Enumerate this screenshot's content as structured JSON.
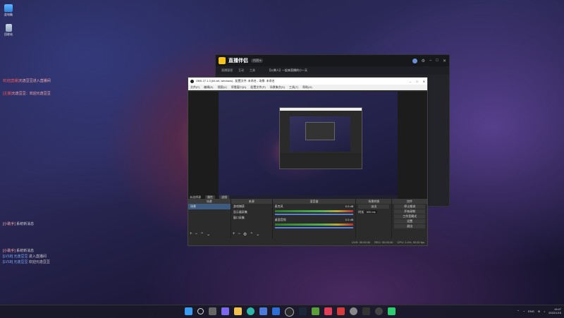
{
  "desktop": {
    "icons": [
      {
        "label": "此电脑",
        "icon": "computer-icon"
      },
      {
        "label": "回收站",
        "icon": "recycle-bin-icon"
      }
    ]
  },
  "chat_overlay": {
    "top": [
      {
        "user": "欢迎[直播]",
        "text": "元逸豆豆进入直播间"
      },
      {
        "user": "[主播]",
        "text": "元逸豆豆：欢迎元逸豆豆"
      }
    ],
    "bottom": [
      {
        "user": "[小助手]",
        "text": "系统新消息"
      },
      {
        "user": "[小助手]",
        "text": "系统新消息"
      },
      {
        "user": "[LV18] 元逸豆豆",
        "text": "进入直播间"
      },
      {
        "user": "[LV18] 元逸豆豆",
        "text": "欢迎元逸豆豆"
      }
    ]
  },
  "live_assistant": {
    "brand": "直播伴侣",
    "badge": "内测 ▾",
    "tabs": [
      "直播管理",
      "互动",
      "工具"
    ],
    "title_text": "【火柴人】一起来直播的小一天"
  },
  "obs": {
    "title": "OBS 27.1.3 (64-bit, windows) - 配置文件: 未命名 - 场景: 未命名",
    "menu": [
      "文件(F)",
      "编辑(E)",
      "视图(V)",
      "停靠窗口(D)",
      "配置文件(P)",
      "场景集合(S)",
      "工具(T)",
      "帮助(H)"
    ],
    "preview_label": "未选择源",
    "toolbar": {
      "props": "属性",
      "filters": "滤镜"
    },
    "docks": {
      "scenes": {
        "header": "场景",
        "items": [
          "场景"
        ]
      },
      "sources": {
        "header": "来源",
        "items": [
          "游戏捕获",
          "显示器采集",
          "窗口采集"
        ]
      },
      "mixer": {
        "header": "混音器",
        "tracks": [
          {
            "name": "麦克风",
            "db": "0.0 dB"
          },
          {
            "name": "桌面音频",
            "db": "0.0 dB"
          }
        ]
      },
      "transitions": {
        "header": "场景转换",
        "type": "淡出",
        "duration_label": "时长",
        "duration": "300 ms"
      },
      "controls": {
        "header": "控件",
        "buttons": [
          "停止推流",
          "开始录制",
          "工作室模式",
          "设置",
          "退出"
        ]
      }
    },
    "status": [
      "LIVE: 00:00:00",
      "REC: 00:00:00",
      "CPU: 2.4%, 30.00 fps"
    ]
  },
  "taskbar": {
    "apps": [
      "start-icon",
      "search-icon",
      "task-view-icon",
      "chat-icon",
      "explorer-icon",
      "edge-icon",
      "store-icon",
      "mail-icon",
      "obs-icon",
      "steam-icon",
      "game-icon",
      "live-icon",
      "music-icon",
      "settings-icon",
      "terminal-icon",
      "record-icon",
      "green-app-icon"
    ],
    "lang": "ENG",
    "time": "19:47",
    "date": "2022/1/15"
  },
  "colors": {
    "accent": "#3d5a80",
    "chat_user": "#ff5a5a",
    "brand": "#f6c21c"
  }
}
